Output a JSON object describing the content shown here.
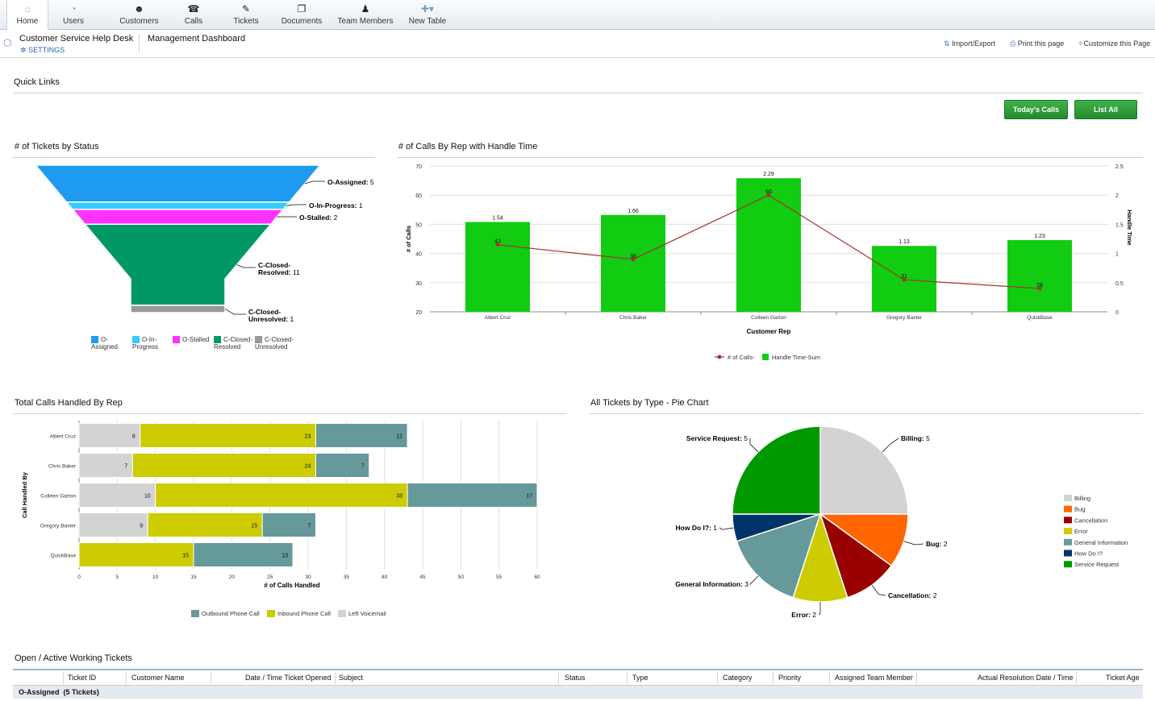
{
  "nav": [
    {
      "label": "Home",
      "icon": "home-icon",
      "glyph": "⌂"
    },
    {
      "label": "Users",
      "icon": "user-icon",
      "glyph": "👤"
    },
    {
      "label": "Customers",
      "icon": "smiley-icon",
      "glyph": "☻"
    },
    {
      "label": "Calls",
      "icon": "phone-icon",
      "glyph": "☎"
    },
    {
      "label": "Tickets",
      "icon": "ticket-icon",
      "glyph": "✎"
    },
    {
      "label": "Documents",
      "icon": "documents-icon",
      "glyph": "❐"
    },
    {
      "label": "Team Members",
      "icon": "team-member-icon",
      "glyph": "♟"
    },
    {
      "label": "New Table",
      "icon": "new-table-icon",
      "glyph": "✚▾"
    }
  ],
  "app": {
    "name": "Customer Service Help Desk",
    "settings": "SETTINGS",
    "page": "Management Dashboard"
  },
  "actions": {
    "import_export": "Import/Export",
    "print": "Print this page",
    "customize": "Customize this Page"
  },
  "quick_links": {
    "title": "Quick Links",
    "todays_calls": "Today's Calls",
    "list_all": "List All"
  },
  "colors": {
    "accent_green": "#2ea33a",
    "nav_bg": "#e6ebf1",
    "blue": "#2a62b5"
  },
  "funnel": {
    "title": "# of Tickets by Status",
    "chart_data": {
      "type": "funnel",
      "categories": [
        "O-Assigned",
        "O-In-Progress",
        "O-Stalled",
        "C-Closed-Resolved",
        "C-Closed-Unresolved"
      ],
      "values": [
        5,
        1,
        2,
        11,
        1
      ],
      "colors": [
        "#1e9bf0",
        "#33ccff",
        "#ff33ff",
        "#009966",
        "#999999"
      ]
    },
    "labels": [
      "O-Assigned: 5",
      "O-In-Progress: 1",
      "O-Stalled: 2",
      "C-Closed-Resolved: 11",
      "C-Closed-Unresolved: 1"
    ],
    "legend": [
      "O-Assigned",
      "O-In-Progress",
      "O-Stalled",
      "C-Closed-Resolved",
      "C-Closed-Unresolved"
    ]
  },
  "combo": {
    "title": "# of Calls By Rep with Handle Time",
    "xlabel": "Customer Rep",
    "ylabel": "# of Calls",
    "y2label": "Handle Time",
    "legend": [
      "# of Calls-",
      "Handle Time-Sum"
    ],
    "chart_data": {
      "type": "bar",
      "categories": [
        "Albert Cruz",
        "Chris Baker",
        "Colleen Garton",
        "Gregory Baxter",
        "QuickBase"
      ],
      "series": [
        {
          "name": "# of Calls-",
          "kind": "line",
          "axis": "left",
          "values": [
            43,
            38,
            60,
            31,
            28
          ],
          "color": "#a83232"
        },
        {
          "name": "Handle Time-Sum",
          "kind": "bar",
          "axis": "right",
          "values": [
            1.54,
            1.66,
            2.29,
            1.13,
            1.23
          ],
          "color": "#11cc11"
        }
      ],
      "ylim": [
        20,
        70
      ],
      "y2lim": [
        0,
        2.5
      ],
      "yticks": [
        20,
        30,
        40,
        50,
        60,
        70
      ],
      "y2ticks": [
        0,
        0.5,
        1,
        1.5,
        2,
        2.5
      ]
    }
  },
  "stacked": {
    "title": "Total Calls Handled By Rep",
    "xlabel": "# of Calls Handled",
    "ylabel": "Call Handled By",
    "legend": [
      "Outbound Phone Call",
      "Inbound Phone Call",
      "Left Voicemail"
    ],
    "chart_data": {
      "type": "bar",
      "orientation": "horizontal-stacked",
      "categories": [
        "Albert Cruz",
        "Chris Baker",
        "Colleen Garton",
        "Gregory Baxter",
        "QuickBase"
      ],
      "series": [
        {
          "name": "Left Voicemail",
          "values": [
            8,
            7,
            10,
            9,
            0
          ],
          "color": "#d3d3d3"
        },
        {
          "name": "Inbound Phone Call",
          "values": [
            23,
            24,
            33,
            15,
            15
          ],
          "color": "#cccc00"
        },
        {
          "name": "Outbound Phone Call",
          "values": [
            12,
            7,
            17,
            7,
            13
          ],
          "color": "#669999"
        }
      ],
      "xlim": [
        0,
        60
      ],
      "xticks": [
        0,
        5,
        10,
        15,
        20,
        25,
        30,
        35,
        40,
        45,
        50,
        55,
        60
      ]
    }
  },
  "pie": {
    "title": "All Tickets by Type - Pie Chart",
    "chart_data": {
      "type": "pie",
      "categories": [
        "Billing",
        "Bug",
        "Cancellation",
        "Error",
        "General Information",
        "How Do I?",
        "Service Request"
      ],
      "values": [
        5,
        2,
        2,
        2,
        3,
        1,
        5
      ],
      "colors": [
        "#d3d3d3",
        "#ff6600",
        "#990000",
        "#cccc00",
        "#669999",
        "#003366",
        "#009900"
      ]
    },
    "labels": [
      "Billing: 5",
      "Bug: 2",
      "Cancellation: 2",
      "Error: 2",
      "General Information: 3",
      "How Do I?: 1",
      "Service Request: 5"
    ],
    "legend": [
      "Billing",
      "Bug",
      "Cancellation",
      "Error",
      "General Information",
      "How Do I?",
      "Service Request"
    ]
  },
  "table": {
    "title": "Open / Active Working Tickets",
    "columns": [
      "Ticket ID",
      "Customer Name",
      "Date / Time Ticket Opened",
      "Subject",
      "Status",
      "Type",
      "Category",
      "Priority",
      "Assigned Team Member",
      "Actual Resolution Date / Time",
      "Ticket Age"
    ],
    "group": "O-Assigned  (5 Tickets)"
  }
}
